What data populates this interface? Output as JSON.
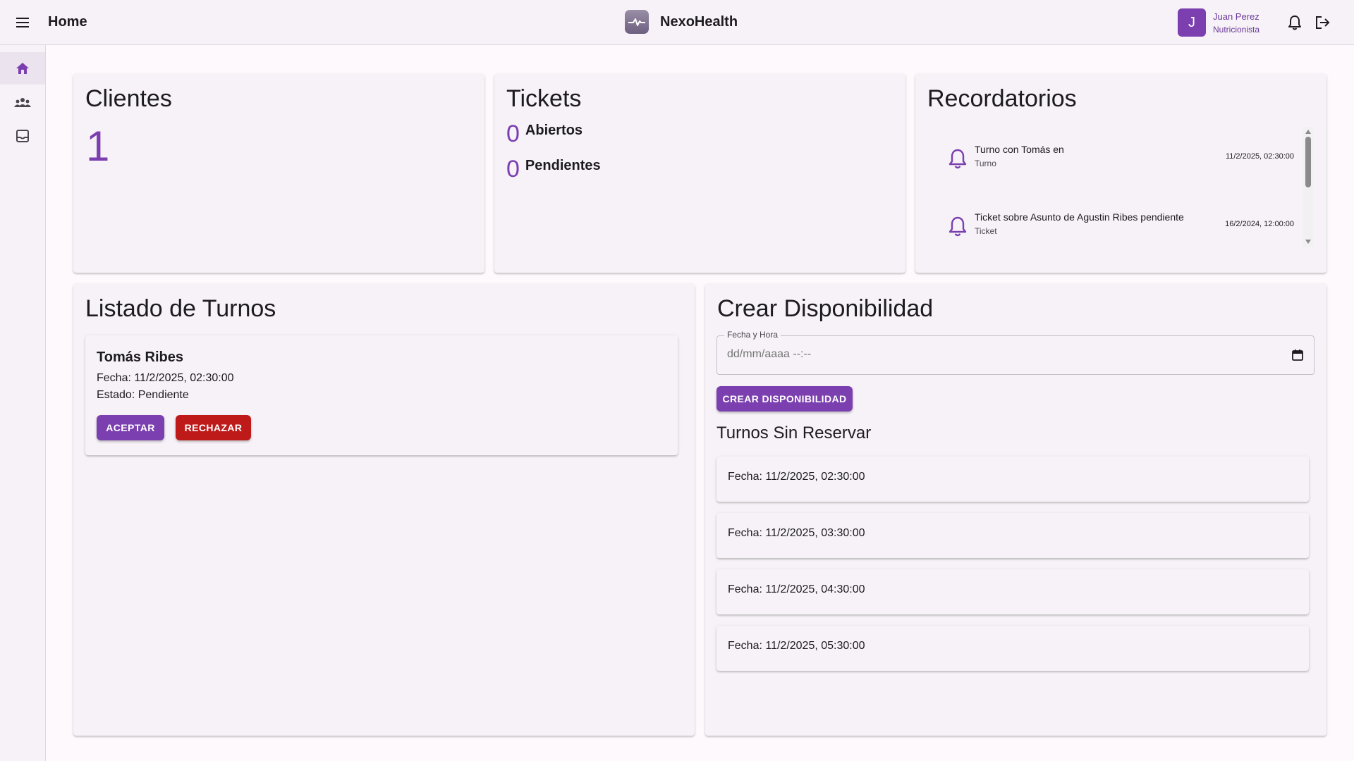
{
  "header": {
    "title": "Home",
    "brand": "NexoHealth",
    "user": {
      "initial": "J",
      "name": "Juan Perez",
      "role": "Nutricionista"
    }
  },
  "sidebar": {
    "items": [
      {
        "icon": "home-icon",
        "active": true
      },
      {
        "icon": "group-icon",
        "active": false
      },
      {
        "icon": "inbox-icon",
        "active": false
      }
    ]
  },
  "clientes": {
    "title": "Clientes",
    "count": "1"
  },
  "tickets": {
    "title": "Tickets",
    "abiertos": {
      "count": "0",
      "label": "Abiertos"
    },
    "pendientes": {
      "count": "0",
      "label": "Pendientes"
    }
  },
  "recordatorios": {
    "title": "Recordatorios",
    "items": [
      {
        "title": "Turno con Tomás en",
        "type": "Turno",
        "time": "11/2/2025, 02:30:00"
      },
      {
        "title": "Ticket sobre Asunto de Agustin Ribes pendiente",
        "type": "Ticket",
        "time": "16/2/2024, 12:00:00"
      }
    ]
  },
  "turnos": {
    "title": "Listado de Turnos",
    "items": [
      {
        "name": "Tomás Ribes",
        "fecha": "Fecha: 11/2/2025, 02:30:00",
        "estado": "Estado: Pendiente",
        "accept_label": "ACEPTAR",
        "reject_label": "RECHAZAR"
      }
    ]
  },
  "disponibilidad": {
    "title": "Crear Disponibilidad",
    "field_label": "Fecha y Hora",
    "field_placeholder": "dd/mm/aaaa --:--",
    "button_label": "CREAR DISPONIBILIDAD",
    "subtitle": "Turnos Sin Reservar",
    "slots": [
      "Fecha: 11/2/2025, 02:30:00",
      "Fecha: 11/2/2025, 03:30:00",
      "Fecha: 11/2/2025, 04:30:00",
      "Fecha: 11/2/2025, 05:30:00"
    ]
  },
  "colors": {
    "accent": "#7b3fb0",
    "danger": "#bf1a1a",
    "surface": "#f6f2f7",
    "background": "#fdf9fd"
  }
}
